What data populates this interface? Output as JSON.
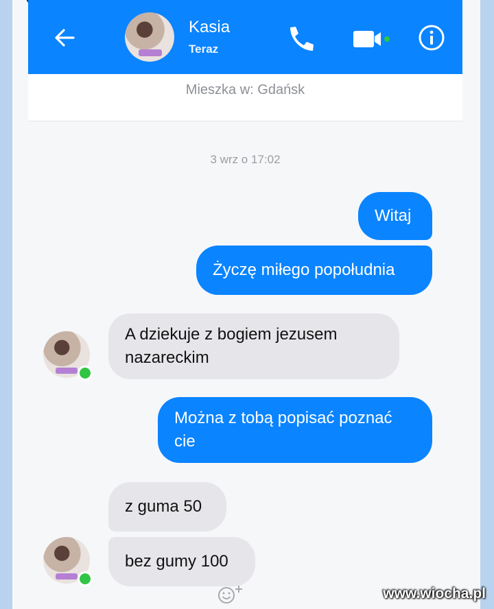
{
  "header": {
    "contact_name": "Kasia",
    "contact_status": "Teraz",
    "icons": [
      "back-arrow-icon",
      "phone-icon",
      "video-camera-icon",
      "info-icon"
    ],
    "accent_color": "#0a84ff"
  },
  "subheader": {
    "lives_in": "Mieszka w: Gdańsk"
  },
  "chat": {
    "timestamp": "3 wrz o 17:02",
    "messages": [
      {
        "from": "me",
        "text": "Witaj"
      },
      {
        "from": "me",
        "text": "Życzę miłego popołudnia"
      },
      {
        "from": "contact",
        "text": "A dziekuje z bogiem jezusem nazareckim"
      },
      {
        "from": "me",
        "text": "Można z tobą popisać poznać cie"
      },
      {
        "from": "contact",
        "text": "z guma 50"
      },
      {
        "from": "contact",
        "text": "bez gumy 100"
      }
    ],
    "online_color": "#31c545"
  },
  "watermark": "www.wiocha.pl"
}
